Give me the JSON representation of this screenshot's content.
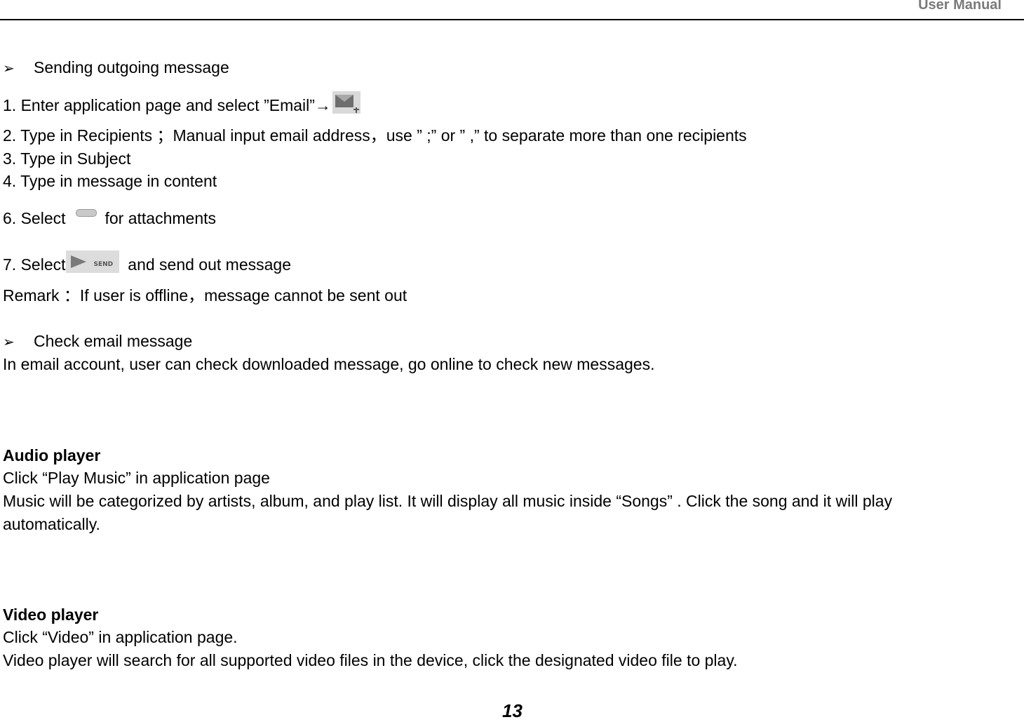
{
  "header": {
    "title": "User Manual"
  },
  "email": {
    "send_heading": {
      "bullet": "➢",
      "text": "Sending outgoing message"
    },
    "steps": {
      "step1": "1. Enter application page and select ”Email”",
      "step1_arrow": "→",
      "step2": "2. Type in Recipients ；Manual input email address，use ” ;” or ” ,” to separate more than one recipients",
      "step3": "3. Type in Subject",
      "step4": "4. Type in message in content",
      "step6_prefix": "6. Select",
      "step6_suffix": "for attachments",
      "step7_prefix": "7. Select",
      "step7_suffix": "and send out message"
    },
    "icons": {
      "compose": "compose-mail-icon",
      "attachment": "paperclip-icon",
      "send": "send-icon",
      "send_label": "SEND"
    },
    "remark": "Remark ：If user is offline，message cannot be sent out",
    "check_heading": {
      "bullet": "➢",
      "text": "Check email message"
    },
    "check_body": "In email account, user can check downloaded message, go online to check new messages."
  },
  "audio": {
    "title": "Audio player",
    "line1": "Click “Play Music” in application page",
    "line2": "Music will be categorized by artists, album, and play list. It will display all music inside “Songs” . Click the song and it will play",
    "line3": "automatically."
  },
  "video": {
    "title": "Video player",
    "line1": "Click “Video” in application page.",
    "line2": "Video player will search for all supported video files in the device, click the designated video file to play."
  },
  "footer": {
    "page_number": "13"
  }
}
